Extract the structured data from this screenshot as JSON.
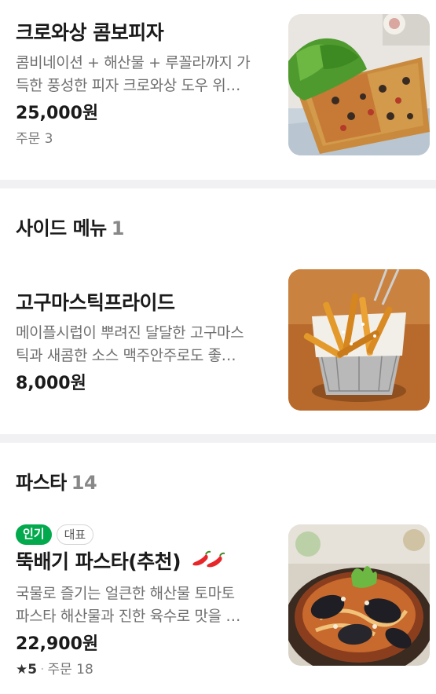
{
  "sections": [
    {
      "items": [
        {
          "name": "크로와상 콤보피자",
          "desc_lines": [
            "콤비네이션 + 해산물 + 루꼴라까지 가",
            "득한 풍성한 피자 크로와상 도우 위…"
          ],
          "price": "25,000원",
          "orders": "주문 3"
        }
      ]
    },
    {
      "title": "사이드 메뉴",
      "count": "1",
      "items": [
        {
          "name": "고구마스틱프라이드",
          "desc_lines": [
            "메이플시럽이 뿌려진 달달한 고구마스",
            "틱과 새콤한 소스 맥주안주로도 좋…"
          ],
          "price": "8,000원"
        }
      ]
    },
    {
      "title": "파스타",
      "count": "14",
      "items": [
        {
          "badges": [
            "인기",
            "대표"
          ],
          "name": "뚝배기 파스타(추천)",
          "spicy_icon": "chili-pepper-icon",
          "desc_lines": [
            "국물로 즐기는 얼큰한 해산물 토마토",
            "파스타 해산물과 진한 육수로 맛을 …"
          ],
          "price": "22,900원",
          "rating_icon": "star-icon",
          "rating": "5",
          "orders": "주문 18"
        }
      ]
    }
  ],
  "colors": {
    "popular_badge": "#03a94d",
    "divider": "#f1f1f3",
    "chili": "#e8262a"
  }
}
